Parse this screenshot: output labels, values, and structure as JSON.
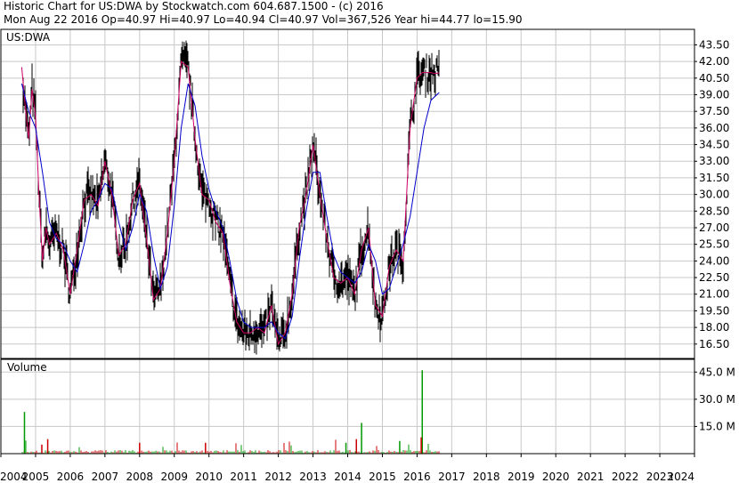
{
  "header": {
    "line1": "Historic Chart for US:DWA  by Stockwatch.com 604.687.1500 - (c) 2016",
    "line2": "Mon Aug 22 2016   Op=40.97   Hi=40.97   Lo=40.94   Cl=40.97   Vol=367,526   Year hi=44.77   lo=15.90"
  },
  "chart_data": {
    "type": "line",
    "price_panel_label": "US:DWA",
    "volume_panel_label": "Volume",
    "price_ticks": [
      "16.50",
      "18.00",
      "19.50",
      "21.00",
      "22.50",
      "24.00",
      "25.50",
      "27.00",
      "28.50",
      "30.00",
      "31.50",
      "33.00",
      "34.50",
      "36.00",
      "37.50",
      "39.00",
      "40.50",
      "42.00",
      "43.50"
    ],
    "price_ylim": [
      15.2,
      44.9
    ],
    "volume_ticks": [
      "15.0 M",
      "30.0 M",
      "45.0 M"
    ],
    "volume_ylim": [
      0,
      52
    ],
    "x_labels": [
      "2004",
      "2005",
      "2006",
      "2007",
      "2008",
      "2009",
      "2010",
      "2011",
      "2012",
      "2013",
      "2014",
      "2015",
      "2016",
      "2017",
      "2018",
      "2019",
      "2020",
      "2021",
      "2022",
      "2023",
      "2024"
    ],
    "xlim": [
      2004.0,
      2024.0
    ],
    "grid": true,
    "series": [
      {
        "color": "#cc0066",
        "x": [
          2004.6,
          2004.7,
          2004.8,
          2004.9,
          2005.0,
          2005.1,
          2005.2,
          2005.3,
          2005.4,
          2005.5,
          2005.6,
          2005.8,
          2006.0,
          2006.2,
          2006.4,
          2006.6,
          2006.8,
          2007.0,
          2007.2,
          2007.4,
          2007.6,
          2007.8,
          2008.0,
          2008.2,
          2008.4,
          2008.6,
          2008.8,
          2009.0,
          2009.2,
          2009.4,
          2009.6,
          2009.8,
          2010.0,
          2010.2,
          2010.4,
          2010.6,
          2010.8,
          2011.0,
          2011.2,
          2011.4,
          2011.6,
          2011.8,
          2012.0,
          2012.2,
          2012.4,
          2012.6,
          2012.8,
          2013.0,
          2013.2,
          2013.4,
          2013.6,
          2013.8,
          2014.0,
          2014.2,
          2014.4,
          2014.6,
          2014.8,
          2015.0,
          2015.2,
          2015.4,
          2015.6,
          2015.8,
          2016.0,
          2016.15,
          2016.3,
          2016.4,
          2016.5,
          2016.64
        ],
        "y": [
          41.5,
          38.0,
          35.0,
          39.5,
          37.0,
          30.0,
          24.0,
          27.0,
          25.5,
          26.0,
          26.5,
          25.0,
          21.0,
          25.0,
          29.5,
          30.0,
          29.0,
          33.0,
          30.0,
          24.5,
          25.5,
          29.5,
          31.0,
          26.0,
          20.5,
          21.5,
          26.5,
          33.0,
          42.0,
          41.5,
          35.0,
          30.0,
          29.5,
          27.5,
          26.5,
          22.0,
          18.5,
          17.5,
          17.5,
          18.0,
          17.5,
          20.0,
          16.5,
          17.5,
          21.0,
          27.0,
          30.0,
          34.5,
          30.0,
          26.0,
          22.5,
          22.0,
          22.5,
          21.0,
          25.0,
          27.0,
          20.0,
          19.0,
          23.5,
          25.0,
          24.0,
          36.0,
          40.5,
          41.0,
          41.0,
          41.0,
          40.9,
          40.97
        ]
      },
      {
        "color": "#0000cc",
        "x": [
          2004.6,
          2004.8,
          2005.0,
          2005.2,
          2005.4,
          2005.6,
          2005.8,
          2006.0,
          2006.2,
          2006.4,
          2006.6,
          2006.8,
          2007.0,
          2007.2,
          2007.4,
          2007.6,
          2007.8,
          2008.0,
          2008.2,
          2008.4,
          2008.6,
          2008.8,
          2009.0,
          2009.2,
          2009.4,
          2009.6,
          2009.8,
          2010.0,
          2010.2,
          2010.4,
          2010.6,
          2010.8,
          2011.0,
          2011.2,
          2011.4,
          2011.6,
          2011.8,
          2012.0,
          2012.2,
          2012.4,
          2012.6,
          2012.8,
          2013.0,
          2013.2,
          2013.4,
          2013.6,
          2013.8,
          2014.0,
          2014.2,
          2014.4,
          2014.6,
          2014.8,
          2015.0,
          2015.2,
          2015.4,
          2015.6,
          2015.8,
          2016.0,
          2016.2,
          2016.4,
          2016.64
        ],
        "y": [
          40.0,
          37.5,
          36.0,
          32.0,
          27.5,
          26.0,
          25.5,
          24.0,
          23.0,
          25.5,
          28.5,
          29.5,
          31.0,
          30.5,
          27.5,
          25.0,
          27.0,
          30.0,
          28.5,
          24.5,
          21.5,
          23.5,
          29.0,
          36.0,
          40.0,
          38.0,
          33.5,
          30.5,
          28.5,
          27.0,
          24.0,
          20.5,
          18.5,
          18.0,
          18.0,
          18.0,
          18.5,
          17.5,
          17.0,
          19.0,
          24.0,
          28.5,
          32.0,
          32.0,
          28.0,
          24.5,
          23.0,
          22.5,
          22.0,
          23.0,
          25.5,
          24.0,
          21.0,
          21.5,
          23.5,
          25.5,
          28.0,
          32.0,
          36.0,
          38.5,
          39.2
        ]
      }
    ]
  }
}
